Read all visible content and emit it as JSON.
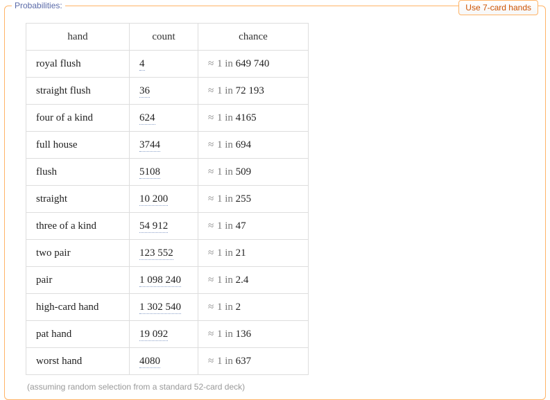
{
  "section_title": "Probabilities:",
  "button_label": "Use 7-card hands",
  "headers": {
    "hand": "hand",
    "count": "count",
    "chance": "chance"
  },
  "approx": "≈",
  "onein": "1 in",
  "rows": [
    {
      "hand": "royal flush",
      "count": "4",
      "chance": "649 740"
    },
    {
      "hand": "straight flush",
      "count": "36",
      "chance": "72 193"
    },
    {
      "hand": "four of a kind",
      "count": "624",
      "chance": "4165"
    },
    {
      "hand": "full house",
      "count": "3744",
      "chance": "694"
    },
    {
      "hand": "flush",
      "count": "5108",
      "chance": "509"
    },
    {
      "hand": "straight",
      "count": "10 200",
      "chance": "255"
    },
    {
      "hand": "three of a kind",
      "count": "54 912",
      "chance": "47"
    },
    {
      "hand": "two pair",
      "count": "123 552",
      "chance": "21"
    },
    {
      "hand": "pair",
      "count": "1 098 240",
      "chance": "2.4"
    },
    {
      "hand": "high-card hand",
      "count": "1 302 540",
      "chance": "2"
    },
    {
      "hand": "pat hand",
      "count": "19 092",
      "chance": "136"
    },
    {
      "hand": "worst hand",
      "count": "4080",
      "chance": "637"
    }
  ],
  "footnote": "(assuming random selection from a standard 52-card deck)"
}
